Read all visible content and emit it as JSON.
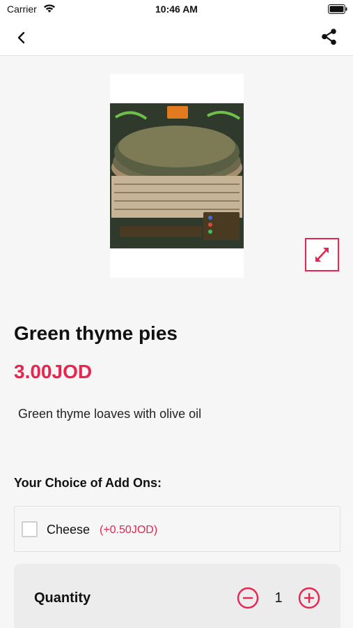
{
  "status_bar": {
    "carrier": "Carrier",
    "time": "10:46 AM"
  },
  "nav": {
    "back_icon": "chevron-left-icon",
    "share_icon": "share-icon"
  },
  "product": {
    "name": "Green thyme pies",
    "price": "3.00JOD",
    "description": "Green thyme loaves with olive oil",
    "image": "product-photo",
    "expand_icon": "expand-arrows-icon"
  },
  "addons": {
    "heading": "Your Choice of Add Ons:",
    "items": [
      {
        "name": "Cheese",
        "price": "(+0.50JOD)",
        "checked": false
      }
    ]
  },
  "quantity": {
    "label": "Quantity",
    "value": "1"
  },
  "colors": {
    "accent": "#e8244f",
    "background": "#f6f6f6"
  }
}
